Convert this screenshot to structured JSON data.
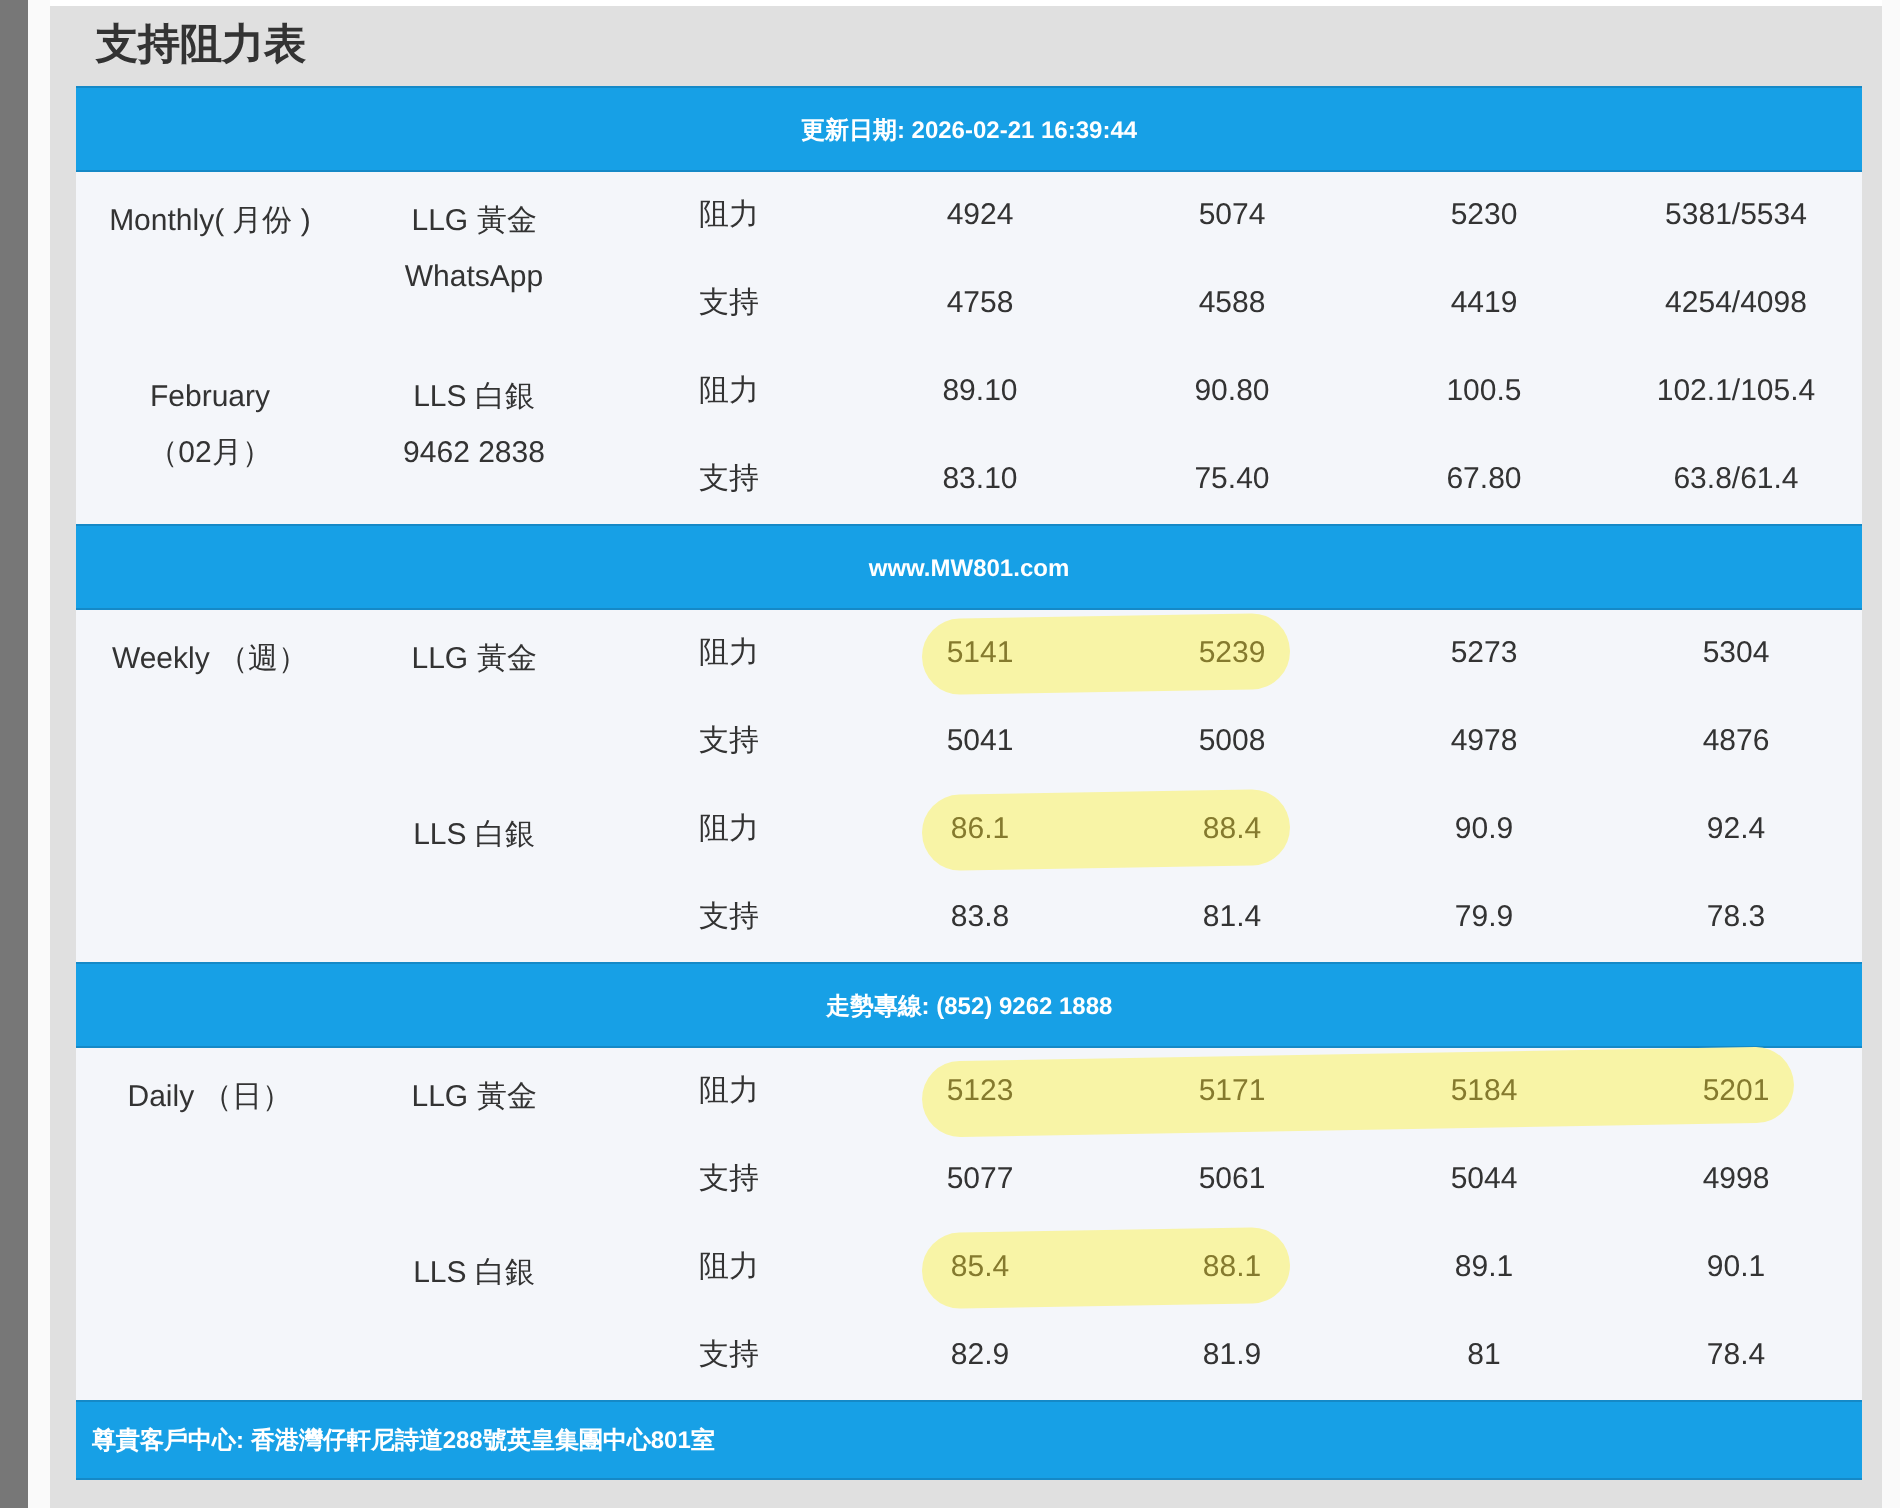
{
  "title": "支持阻力表",
  "sections": [
    {
      "banner": "更新日期: 2026-02-21 16:39:44",
      "products": [
        {
          "period": [
            "Monthly( 月份 )"
          ],
          "product": [
            "LLG 黃金",
            "WhatsApp"
          ],
          "rows": [
            {
              "type": "阻力",
              "values": [
                {
                  "text": "4924",
                  "highlighted": false
                },
                {
                  "text": "5074",
                  "highlighted": false
                },
                {
                  "text": "5230",
                  "highlighted": false
                },
                {
                  "text": "5381/5534",
                  "highlighted": false
                }
              ]
            },
            {
              "type": "支持",
              "values": [
                {
                  "text": "4758",
                  "highlighted": false
                },
                {
                  "text": "4588",
                  "highlighted": false
                },
                {
                  "text": "4419",
                  "highlighted": false
                },
                {
                  "text": "4254/4098",
                  "highlighted": false
                }
              ]
            }
          ]
        },
        {
          "period": [
            "February",
            "（02月）"
          ],
          "product": [
            "LLS 白銀",
            "9462 2838"
          ],
          "rows": [
            {
              "type": "阻力",
              "values": [
                {
                  "text": "89.10",
                  "highlighted": false
                },
                {
                  "text": "90.80",
                  "highlighted": false
                },
                {
                  "text": "100.5",
                  "highlighted": false
                },
                {
                  "text": "102.1/105.4",
                  "highlighted": false
                }
              ]
            },
            {
              "type": "支持",
              "values": [
                {
                  "text": "83.10",
                  "highlighted": false
                },
                {
                  "text": "75.40",
                  "highlighted": false
                },
                {
                  "text": "67.80",
                  "highlighted": false
                },
                {
                  "text": "63.8/61.4",
                  "highlighted": false
                }
              ]
            }
          ]
        }
      ]
    },
    {
      "banner": "www.MW801.com",
      "products": [
        {
          "period": [
            "Weekly （週）"
          ],
          "product": [
            "LLG 黃金"
          ],
          "rows": [
            {
              "type": "阻力",
              "values": [
                {
                  "text": "5141",
                  "highlighted": true
                },
                {
                  "text": "5239",
                  "highlighted": true
                },
                {
                  "text": "5273",
                  "highlighted": false
                },
                {
                  "text": "5304",
                  "highlighted": false
                }
              ]
            },
            {
              "type": "支持",
              "values": [
                {
                  "text": "5041",
                  "highlighted": false
                },
                {
                  "text": "5008",
                  "highlighted": false
                },
                {
                  "text": "4978",
                  "highlighted": false
                },
                {
                  "text": "4876",
                  "highlighted": false
                }
              ]
            }
          ]
        },
        {
          "product": [
            "LLS 白銀"
          ],
          "rows": [
            {
              "type": "阻力",
              "values": [
                {
                  "text": "86.1",
                  "highlighted": true
                },
                {
                  "text": "88.4",
                  "highlighted": true
                },
                {
                  "text": "90.9",
                  "highlighted": false
                },
                {
                  "text": "92.4",
                  "highlighted": false
                }
              ]
            },
            {
              "type": "支持",
              "values": [
                {
                  "text": "83.8",
                  "highlighted": false
                },
                {
                  "text": "81.4",
                  "highlighted": false
                },
                {
                  "text": "79.9",
                  "highlighted": false
                },
                {
                  "text": "78.3",
                  "highlighted": false
                }
              ]
            }
          ]
        }
      ]
    },
    {
      "banner": "走勢專線: (852) 9262 1888",
      "products": [
        {
          "period": [
            "Daily （日）"
          ],
          "product": [
            "LLG 黃金"
          ],
          "rows": [
            {
              "type": "阻力",
              "values": [
                {
                  "text": "5123",
                  "highlighted": true
                },
                {
                  "text": "5171",
                  "highlighted": true
                },
                {
                  "text": "5184",
                  "highlighted": true
                },
                {
                  "text": "5201",
                  "highlighted": true
                }
              ]
            },
            {
              "type": "支持",
              "values": [
                {
                  "text": "5077",
                  "highlighted": false
                },
                {
                  "text": "5061",
                  "highlighted": false
                },
                {
                  "text": "5044",
                  "highlighted": false
                },
                {
                  "text": "4998",
                  "highlighted": false
                }
              ]
            }
          ]
        },
        {
          "product": [
            "LLS 白銀"
          ],
          "rows": [
            {
              "type": "阻力",
              "values": [
                {
                  "text": "85.4",
                  "highlighted": true
                },
                {
                  "text": "88.1",
                  "highlighted": true
                },
                {
                  "text": "89.1",
                  "highlighted": false
                },
                {
                  "text": "90.1",
                  "highlighted": false
                }
              ]
            },
            {
              "type": "支持",
              "values": [
                {
                  "text": "82.9",
                  "highlighted": false
                },
                {
                  "text": "81.9",
                  "highlighted": false
                },
                {
                  "text": "81",
                  "highlighted": false
                },
                {
                  "text": "78.4",
                  "highlighted": false
                }
              ]
            }
          ]
        }
      ]
    }
  ],
  "footer": "尊貴客戶中心: 香港灣仔軒尼詩道288號英皇集團中心801室"
}
